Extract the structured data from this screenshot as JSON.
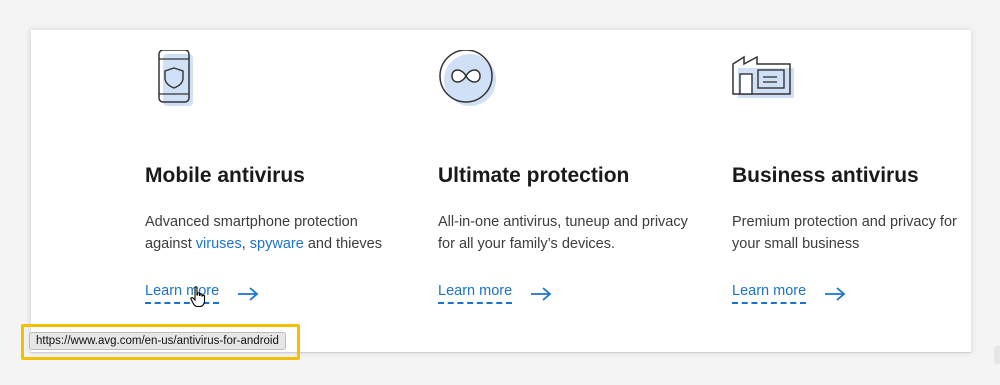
{
  "cards": [
    {
      "title": "Mobile antivirus",
      "desc_prefix": "Advanced smartphone protection against ",
      "link1": "viruses",
      "sep": ", ",
      "link2": "spyware",
      "desc_suffix": " and thieves",
      "cta": "Learn more",
      "icon": "smartphone-shield-icon"
    },
    {
      "title": "Ultimate protection",
      "desc": "All-in-one antivirus, tuneup and privacy for all your family’s devices.",
      "cta": "Learn more",
      "icon": "infinity-circle-icon"
    },
    {
      "title": "Business antivirus",
      "desc": "Premium protection and privacy for your small business",
      "cta": "Learn more",
      "icon": "building-icon"
    }
  ],
  "status_bar": {
    "url": "https://www.avg.com/en-us/antivirus-for-android"
  },
  "colors": {
    "link": "#1a73d0",
    "highlight": "#f2c000",
    "icon_fill": "#cfe0f7"
  }
}
